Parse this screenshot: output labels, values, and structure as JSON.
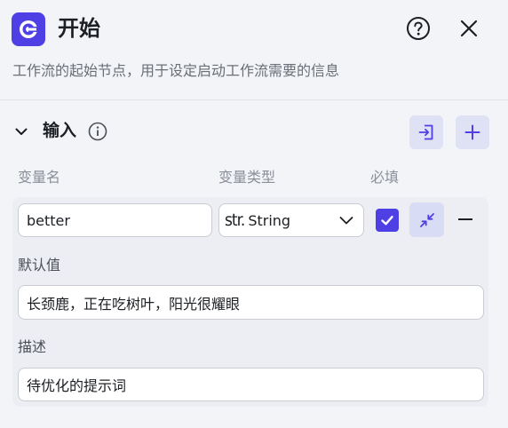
{
  "header": {
    "title": "开始",
    "subtitle": "工作流的起始节点，用于设定启动工作流需要的信息",
    "logo_icon": "start-node-logo-icon",
    "help_icon": "question-circle-icon",
    "close_icon": "close-icon"
  },
  "inputs_section": {
    "title": "输入",
    "expanded": true,
    "info_icon": "info-circle-icon",
    "import_icon": "import-icon",
    "add_icon": "plus-icon",
    "columns": {
      "name": "变量名",
      "type": "变量类型",
      "required": "必填"
    },
    "variables": [
      {
        "name": "better",
        "type_prefix": "str.",
        "type": "String",
        "required": true,
        "default_label": "默认值",
        "default_value": "长颈鹿，正在吃树叶，阳光很耀眼",
        "description_label": "描述",
        "description_value": "待优化的提示词"
      }
    ]
  },
  "colors": {
    "accent": "#4e40e5",
    "accent_soft": "#dfe1f5",
    "panel_bg": "#f3f4f8",
    "card_bg": "#eceef4",
    "muted_text": "#8b8f98"
  }
}
